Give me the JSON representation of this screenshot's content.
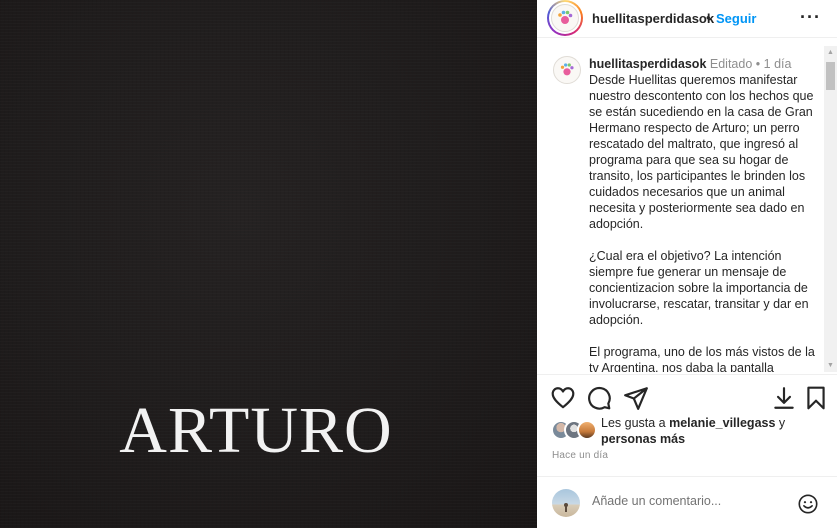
{
  "media": {
    "title": "ARTURO",
    "background_color": "#1f1c1c"
  },
  "header": {
    "username": "huellitasperdidasok",
    "separator": "•",
    "follow_label": "Seguir",
    "more_label": "···",
    "follow_color": "#0095f6"
  },
  "caption": {
    "username": "huellitasperdidasok",
    "edited": "Editado",
    "dot": "•",
    "time": "1 día",
    "paragraphs": [
      "Desde Huellitas queremos manifestar nuestro descontento con los hechos que se están sucediendo en la casa de Gran Hermano respecto de Arturo; un perro rescatado del maltrato, que ingresó al programa para que sea su hogar de transito, los participantes le brinden los cuidados necesarios que un animal necesita y posteriormente sea dado en adopción.",
      "¿Cual era el objetivo? La intención siempre fue generar un mensaje de concientizacion sobre la importancia de involucrarse, rescatar, transitar y dar en adopción.",
      "El programa, uno de los más vistos de la tv Argentina, nos daba la pantalla"
    ]
  },
  "actions": {
    "like": "heart-icon",
    "comment": "comment-icon",
    "share": "share-icon",
    "download": "download-icon",
    "save": "bookmark-icon"
  },
  "likes": {
    "prefix": "Les gusta a ",
    "user": "melanie_villegass",
    "conjunction": " y ",
    "others": "personas más"
  },
  "timestamp": "Hace un día",
  "comment_box": {
    "placeholder": "Añade un comentario..."
  }
}
